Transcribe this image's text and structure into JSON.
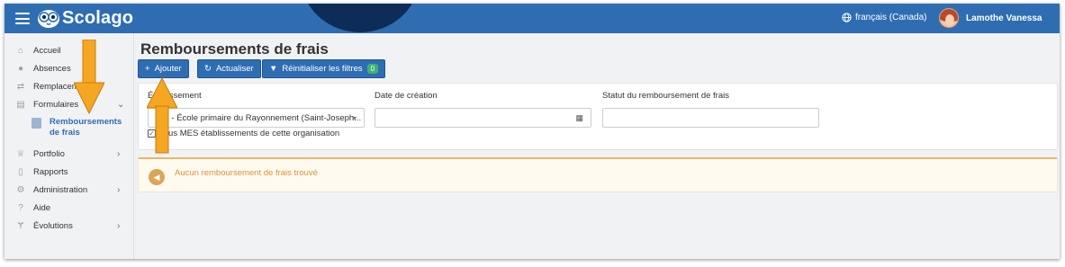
{
  "app": {
    "brand": "Scolago"
  },
  "header": {
    "language": "français (Canada)",
    "user_name": "Lamothe Vanessa"
  },
  "sidebar": {
    "items": [
      {
        "label": "Accueil",
        "icon": "home-icon",
        "has_chevron": false
      },
      {
        "label": "Absences",
        "icon": "users-icon",
        "has_chevron": false
      },
      {
        "label": "Remplacements",
        "icon": "swap-icon",
        "has_chevron": false
      },
      {
        "label": "Formulaires",
        "icon": "form-icon",
        "has_chevron": true,
        "expanded": true
      },
      {
        "label": "Portfolio",
        "icon": "trophy-icon",
        "has_chevron": true
      },
      {
        "label": "Rapports",
        "icon": "report-icon",
        "has_chevron": false
      },
      {
        "label": "Administration",
        "icon": "gear-icon",
        "has_chevron": true
      },
      {
        "label": "Aide",
        "icon": "help-icon",
        "has_chevron": false
      },
      {
        "label": "Évolutions",
        "icon": "plant-icon",
        "has_chevron": true
      }
    ],
    "sub_item": {
      "label_line1": "Remboursements",
      "label_line2": "de frais"
    }
  },
  "main": {
    "title": "Remboursements de frais",
    "toolbar": {
      "add_label": "Ajouter",
      "refresh_label": "Actualiser",
      "reset_filters_label": "Réinitialiser les filtres",
      "reset_filters_count": "0"
    },
    "filters": {
      "establishment_label": "Établissement",
      "establishment_value": "C... - École primaire du Rayonnement (Saint-Joseph...",
      "creation_date_label": "Date de création",
      "creation_date_value": "",
      "status_label": "Statut du remboursement de frais",
      "status_value": "",
      "all_establishments_label": "Tous MES établissements de cette organisation",
      "all_establishments_checked": true
    },
    "empty_message": "Aucun remboursement de frais trouvé"
  },
  "colors": {
    "brand_blue": "#2f6db3",
    "navy": "#0d2c57",
    "badge_green": "#3cb371",
    "alert_text": "#d4953a",
    "annotation_orange": "#f5a623"
  }
}
